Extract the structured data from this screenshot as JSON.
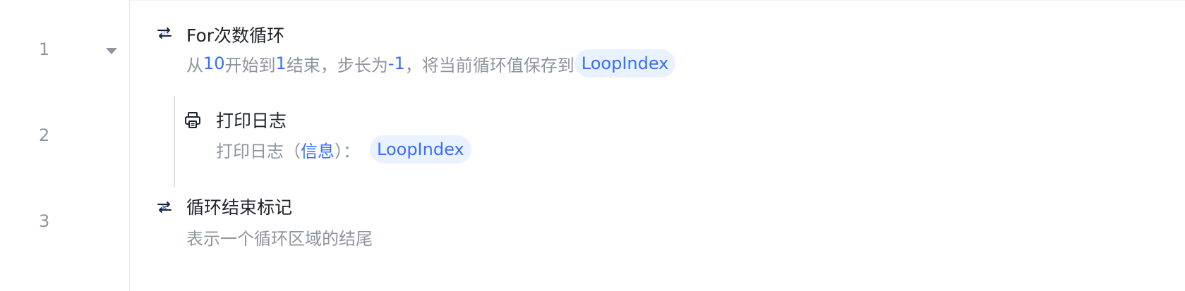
{
  "gutter": {
    "line_numbers": [
      "1",
      "2",
      "3"
    ]
  },
  "steps": [
    {
      "title": "For次数循环",
      "icon": "loop-count-icon",
      "desc": {
        "prefix": "从",
        "start": "10",
        "mid1": "开始到",
        "end": "1",
        "mid2": "结束，步长为",
        "step": "-1",
        "mid3": "，将当前循环值保存到",
        "variable": "LoopIndex"
      }
    },
    {
      "title": "打印日志",
      "icon": "printer-icon",
      "desc": {
        "prefix": "打印日志（",
        "level": "信息",
        "suffix": "）：",
        "variable": "LoopIndex"
      }
    },
    {
      "title": "循环结束标记",
      "icon": "loop-end-icon",
      "desc": {
        "text": "表示一个循环区域的结尾"
      }
    }
  ],
  "colors": {
    "accent": "#3370ff",
    "chip_bg": "#eaf2ff",
    "muted_text": "#8f959e",
    "primary_text": "#1f2329"
  }
}
